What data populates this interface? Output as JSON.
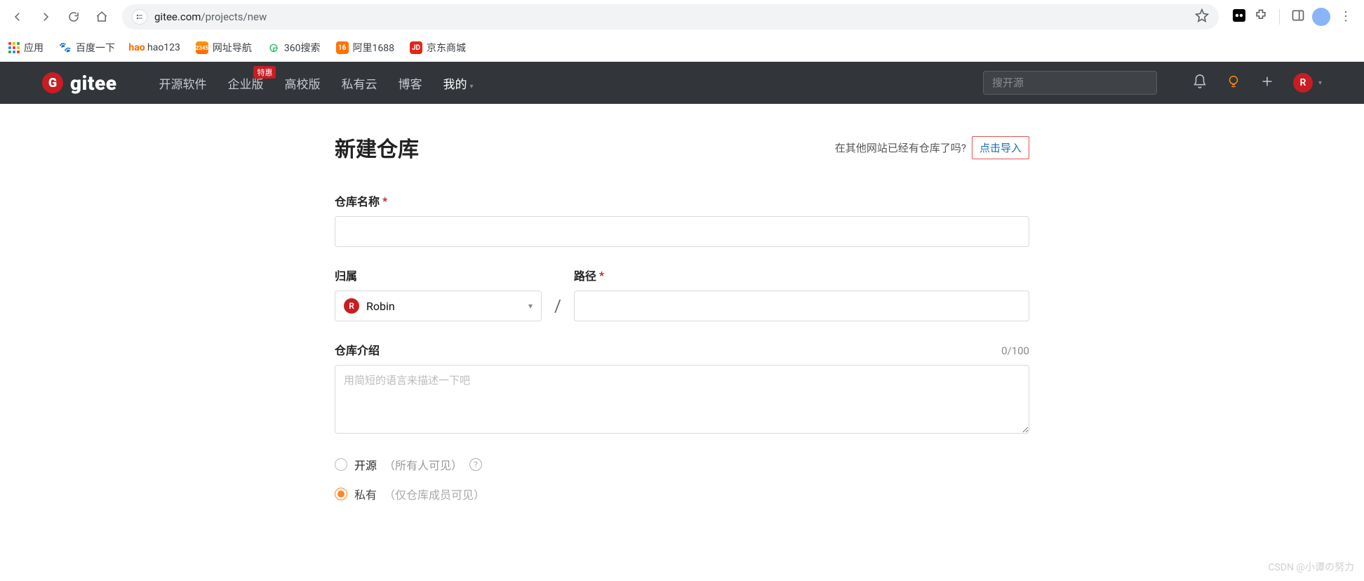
{
  "browser": {
    "url_host": "gitee.com",
    "url_path": "/projects/new"
  },
  "bookmarks": {
    "apps": "应用",
    "baidu": "百度一下",
    "hao123": "hao123",
    "nav2345_ic": "2345",
    "nav2345": "网址导航",
    "so360": "360搜索",
    "ali1688": "阿里1688",
    "jd": "京东商城",
    "jd_ic": "JD"
  },
  "gitee": {
    "logo_text": "gitee",
    "nav": {
      "opensource": "开源软件",
      "enterprise": "企业版",
      "enterprise_badge": "特惠",
      "university": "高校版",
      "private_cloud": "私有云",
      "blog": "博客",
      "mine": "我的"
    },
    "search_placeholder": "搜开源",
    "avatar_initial": "R"
  },
  "page": {
    "title": "新建仓库",
    "import_q": "在其他网站已经有仓库了吗?",
    "import_link": "点击导入",
    "repo_name_label": "仓库名称",
    "owner_label": "归属",
    "path_label": "路径",
    "owner_value": "Robin",
    "owner_initial": "R",
    "path_sep": "/",
    "desc_label": "仓库介绍",
    "desc_counter": "0/100",
    "desc_placeholder": "用简短的语言来描述一下吧",
    "vis_public": "开源",
    "vis_public_hint": "（所有人可见）",
    "vis_private": "私有",
    "vis_private_hint": "（仅仓库成员可见）"
  },
  "watermark": "CSDN @小谭の努力"
}
